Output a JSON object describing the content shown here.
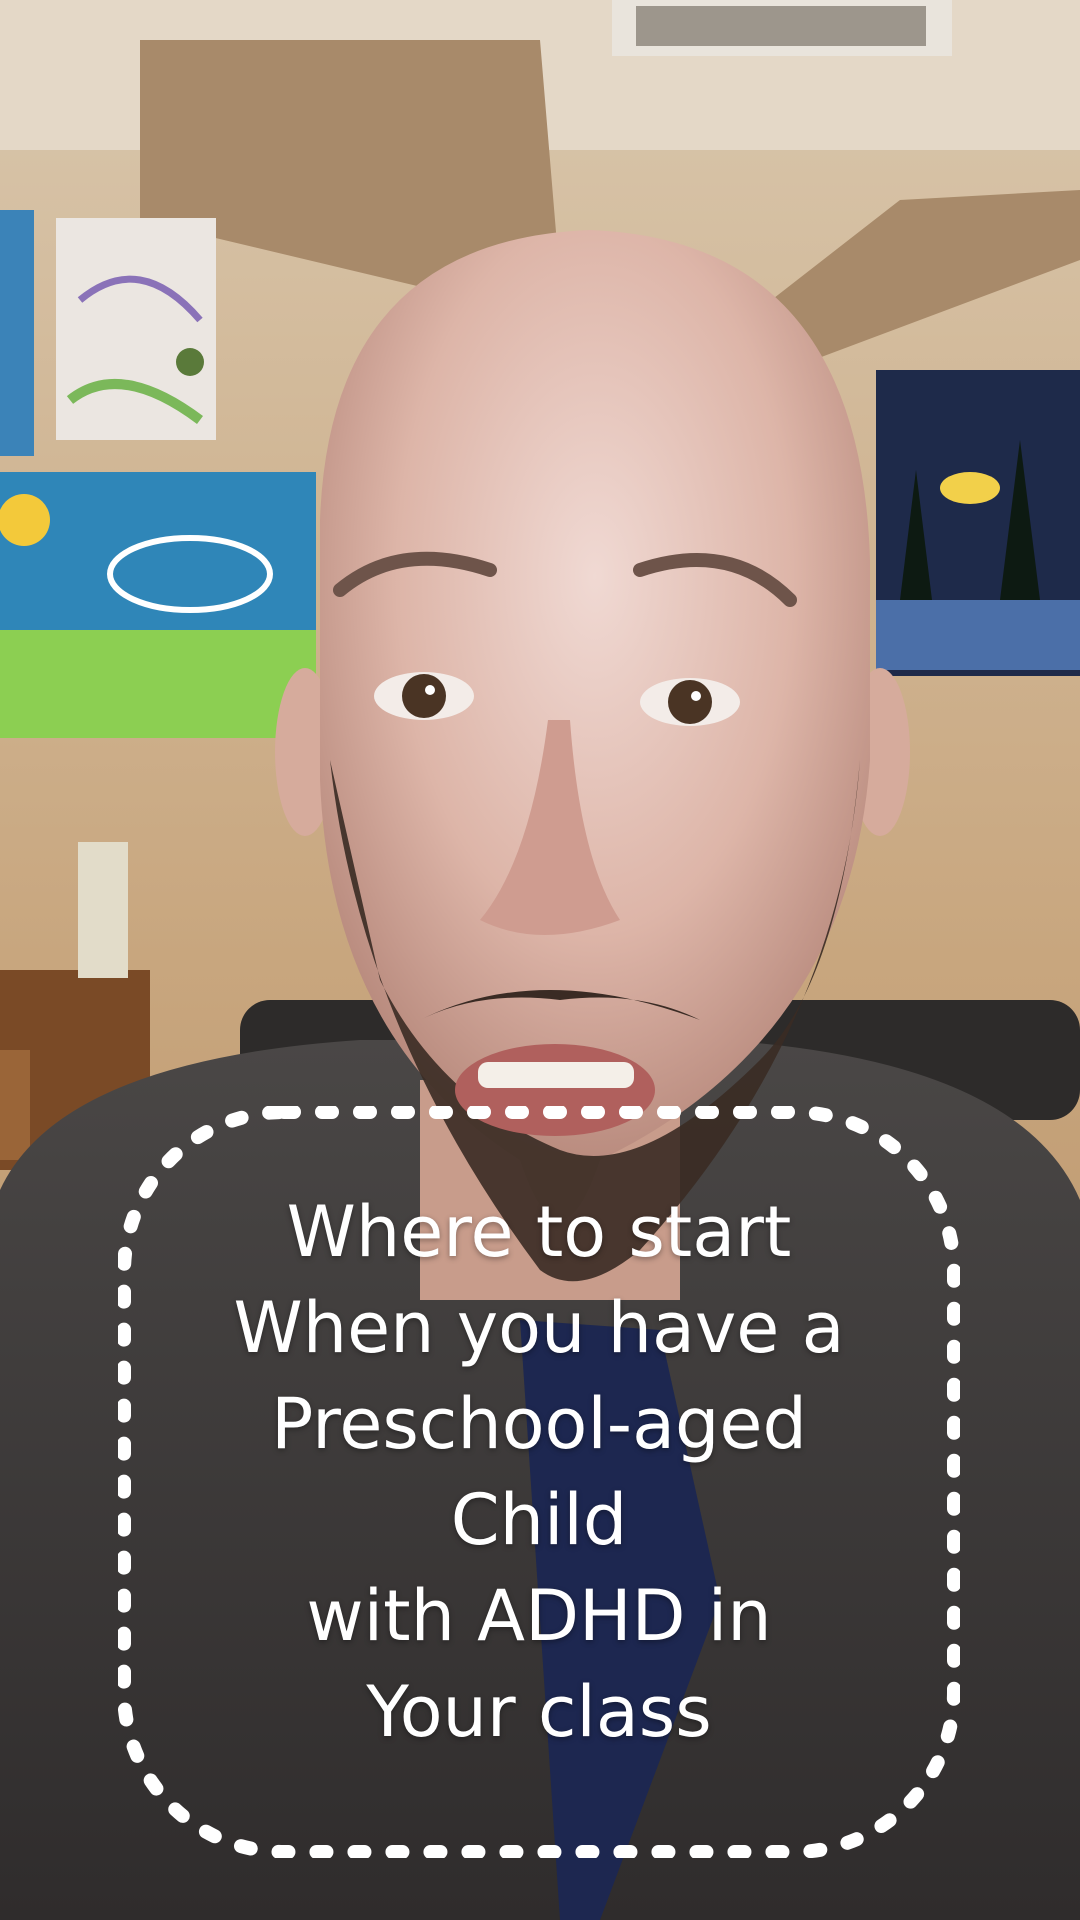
{
  "caption": {
    "lines": [
      "Where to start",
      "When you have a",
      "Preschool-aged",
      "Child",
      "with ADHD in",
      "Your class"
    ],
    "text_color": "#ffffff",
    "border_color": "#ffffff",
    "border_style": "dashed rounded square"
  }
}
